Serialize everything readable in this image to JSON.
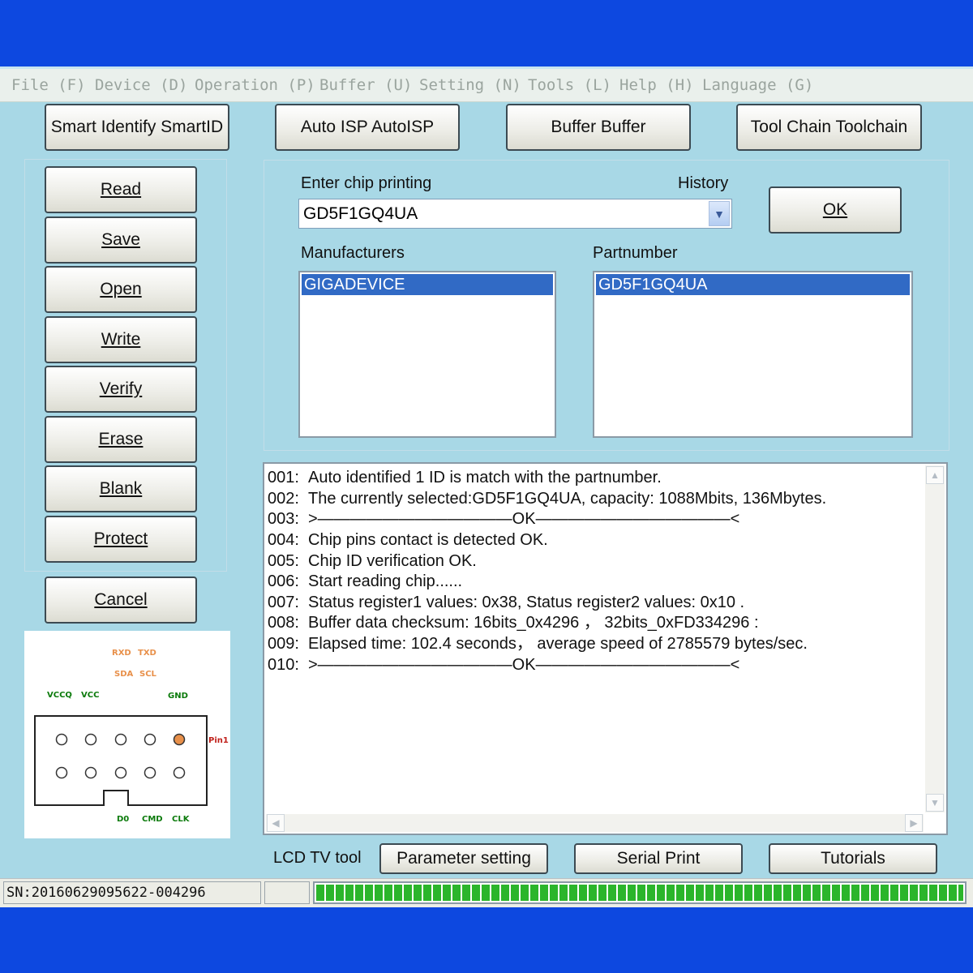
{
  "menu": {
    "file": "File (F)",
    "device": "Device (D)",
    "operation": "Operation (P)",
    "buffer": "Buffer (U)",
    "setting": "Setting (N)",
    "tools": "Tools (L)",
    "help": "Help (H)",
    "language": "Language (G)"
  },
  "toolbar": {
    "smartid": "Smart Identify SmartID",
    "autoisp": "Auto ISP AutoISP",
    "buffer": "Buffer Buffer",
    "toolchain": "Tool Chain Toolchain"
  },
  "side_buttons": {
    "read": "Read",
    "save": "Save",
    "open": "Open",
    "write": "Write",
    "verify": "Verify",
    "erase": "Erase",
    "blank": "Blank",
    "protect": "Protect",
    "cancel": "Cancel"
  },
  "chip_select": {
    "enter_label": "Enter chip printing",
    "history_label": "History",
    "chip_value": "GD5F1GQ4UA",
    "ok_label": "OK",
    "manufacturers_label": "Manufacturers",
    "partnumber_label": "Partnumber",
    "manufacturer_selected": "GIGADEVICE",
    "partnumber_selected": "GD5F1GQ4UA"
  },
  "log": [
    {
      "n": "001:",
      "text": "Auto identified 1 ID is match with the partnumber."
    },
    {
      "n": "002:",
      "text": "The currently selected:GD5F1GQ4UA, capacity: 1088Mbits, 136Mbytes."
    },
    {
      "n": "003:",
      "text": ">————————————OK————————————<"
    },
    {
      "n": "004:",
      "text": "Chip pins contact is detected OK."
    },
    {
      "n": "005:",
      "text": "Chip ID verification OK."
    },
    {
      "n": "006:",
      "text": "Start reading chip......"
    },
    {
      "n": "007:",
      "text": "Status register1 values: 0x38, Status register2 values: 0x10 ."
    },
    {
      "n": "008:",
      "text": "Buffer data checksum: 16bits_0x4296 ， 32bits_0xFD334296 :"
    },
    {
      "n": "009:",
      "text": "Elapsed time: 102.4 seconds， average speed of 2785579 bytes/sec."
    },
    {
      "n": "010:",
      "text": ">————————————OK————————————<"
    }
  ],
  "pinout": {
    "rxd": "RXD",
    "txd": "TXD",
    "sda": "SDA",
    "scl": "SCL",
    "vccq": "VCCQ",
    "vcc": "VCC",
    "gnd": "GND",
    "pin1": "Pin1",
    "d0": "D0",
    "cmd": "CMD",
    "clk": "CLK"
  },
  "bottom": {
    "lcd_label": "LCD TV tool",
    "param_btn": "Parameter setting",
    "serial_btn": "Serial Print",
    "tutorials_btn": "Tutorials"
  },
  "status": {
    "sn": "SN:20160629095622-004296",
    "progress_percent": 100
  },
  "colors": {
    "background": "#0d48e0",
    "window": "#a8d8e6",
    "selection": "#316ac5",
    "progress": "#2bb52b",
    "pin1_marker": "#e8904a"
  }
}
